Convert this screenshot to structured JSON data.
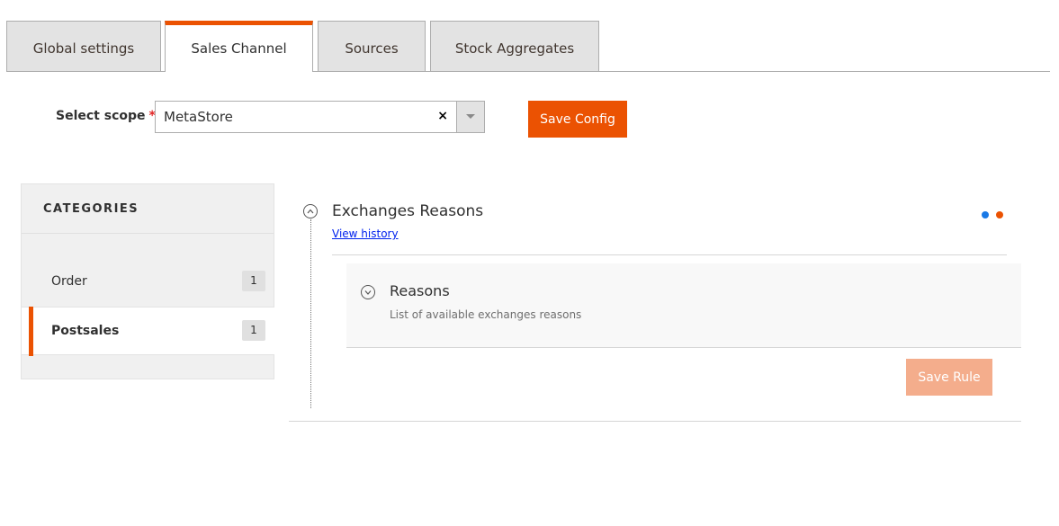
{
  "tabs": [
    {
      "label": "Global settings",
      "active": false
    },
    {
      "label": "Sales Channel",
      "active": true
    },
    {
      "label": "Sources",
      "active": false
    },
    {
      "label": "Stock Aggregates",
      "active": false
    }
  ],
  "scope": {
    "label": "Select scope",
    "required_marker": "*",
    "value": "MetaStore",
    "clear_icon": "×"
  },
  "toolbar": {
    "save_config_label": "Save Config"
  },
  "sidebar": {
    "title": "CATEGORIES",
    "items": [
      {
        "label": "Order",
        "count": "1",
        "active": false
      },
      {
        "label": "Postsales",
        "count": "1",
        "active": true
      }
    ]
  },
  "section": {
    "title": "Exchanges Reasons",
    "view_history_label": "View history",
    "status_dots": [
      {
        "name": "blue",
        "color": "#1979e6"
      },
      {
        "name": "orange",
        "color": "#eb5202"
      }
    ],
    "subsection": {
      "title": "Reasons",
      "description": "List of available exchanges reasons"
    },
    "save_rule_label": "Save Rule"
  },
  "colors": {
    "accent": "#eb5202",
    "accent_disabled": "#f4ad8c",
    "link": "#0022ee"
  }
}
